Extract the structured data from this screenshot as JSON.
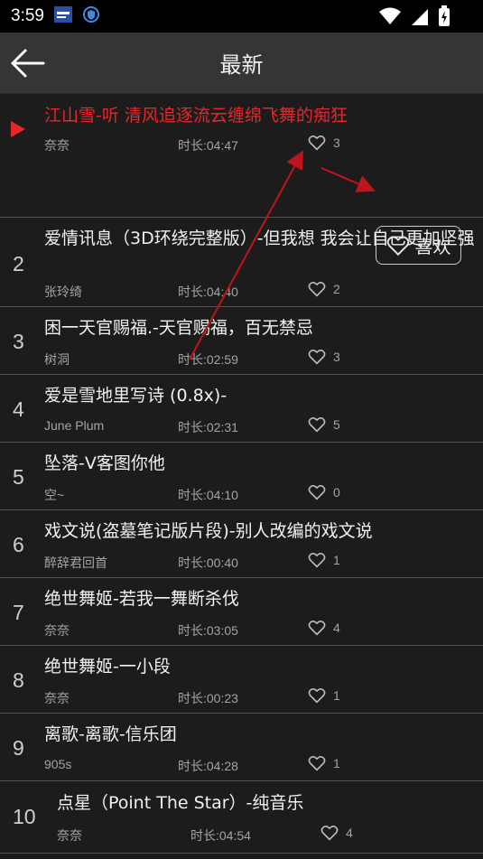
{
  "status": {
    "time": "3:59"
  },
  "header": {
    "title": "最新"
  },
  "now_playing": {
    "title": "江山雪-听 清风追逐流云缠绵飞舞的痴狂",
    "artist": "奈奈",
    "duration": "时长:04:47",
    "likes": "3",
    "like_button_label": "喜欢"
  },
  "songs": [
    {
      "num": "2",
      "title": "爱情讯息（3D环绕完整版）-但我想 我会让自己更加坚强",
      "artist": "张玲绮",
      "duration": "时长:04:40",
      "likes": "2"
    },
    {
      "num": "3",
      "title": "困一天官赐福.-天官赐福，百无禁忌",
      "artist": "树洞",
      "duration": "时长:02:59",
      "likes": "3"
    },
    {
      "num": "4",
      "title": "爱是雪地里写诗 (0.8x)-",
      "artist": "June Plum",
      "duration": "时长:02:31",
      "likes": "5"
    },
    {
      "num": "5",
      "title": "坠落-V客图你他",
      "artist": "空~",
      "duration": "时长:04:10",
      "likes": "0"
    },
    {
      "num": "6",
      "title": "戏文说(盗墓笔记版片段)-别人改编的戏文说",
      "artist": "醉辞君回首",
      "duration": "时长:00:40",
      "likes": "1"
    },
    {
      "num": "7",
      "title": "绝世舞姬-若我一舞断杀伐",
      "artist": "奈奈",
      "duration": "时长:03:05",
      "likes": "4"
    },
    {
      "num": "8",
      "title": "绝世舞姬-一小段",
      "artist": "奈奈",
      "duration": "时长:00:23",
      "likes": "1"
    },
    {
      "num": "9",
      "title": "离歌-离歌-信乐团",
      "artist": "905s",
      "duration": "时长:04:28",
      "likes": "1"
    },
    {
      "num": "10",
      "title": "点星（Point The Star）-纯音乐",
      "artist": "奈奈",
      "duration": "时长:04:54",
      "likes": "4"
    }
  ],
  "colors": {
    "accent": "#e8262a",
    "background": "#1c1c1c",
    "topbar": "#353535",
    "annotation": "#c0141c"
  }
}
